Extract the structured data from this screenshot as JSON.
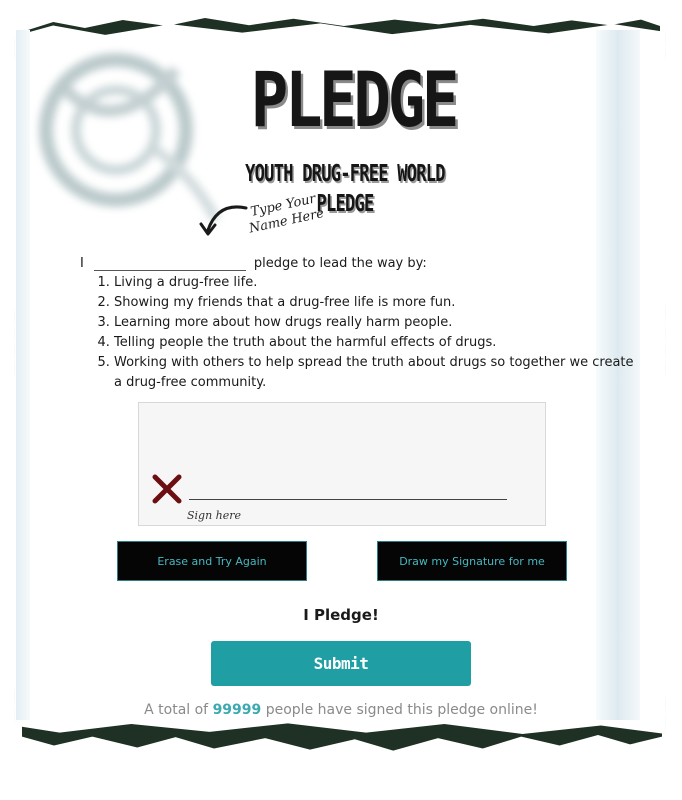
{
  "header": {
    "title": "PLEDGE",
    "subtitle": "YOUTH DRUG-FREE WORLD PLEDGE"
  },
  "name_hint": {
    "line1": "Type Your",
    "line2": "Name Here",
    "icon": "curved-arrow-icon"
  },
  "pledge": {
    "prefix": "I",
    "name_value": "",
    "suffix": "pledge to lead the way by:",
    "items": [
      "Living a drug-free life.",
      "Showing my friends that a drug-free life is more fun.",
      "Learning more about how drugs really harm people.",
      "Telling people the truth about the harmful effects of drugs.",
      "Working with others to help spread the truth about drugs so together we create a drug-free community."
    ]
  },
  "signature": {
    "sign_hint": "Sign here",
    "icon": "x-mark-icon",
    "x_color": "#6b0f12"
  },
  "buttons": {
    "erase_label": "Erase and Try Again",
    "draw_label": "Draw my Signature for me",
    "pledge_heading": "I Pledge!",
    "submit_label": "Submit"
  },
  "footer": {
    "prefix": "A total of",
    "count": "99999",
    "suffix": "people have signed this pledge online!"
  },
  "colors": {
    "accent": "#1f9ea4",
    "torn_edge": "#1e3124",
    "button_text": "#47b7c0"
  }
}
